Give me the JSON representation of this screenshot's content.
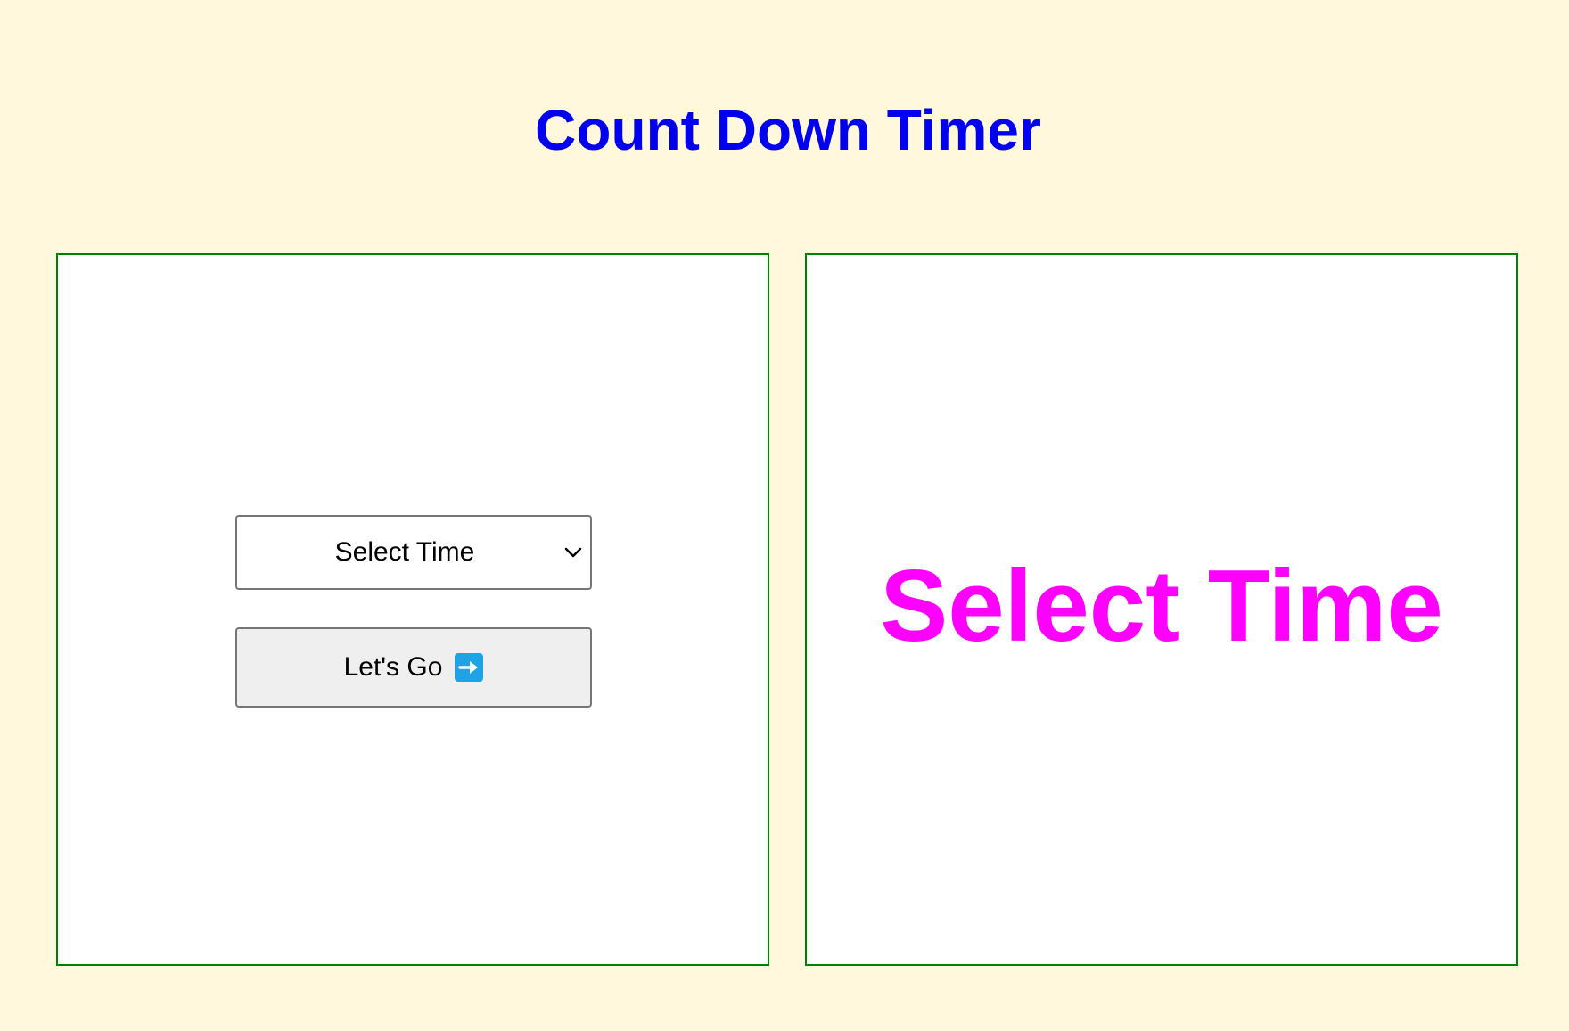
{
  "header": {
    "title": "Count Down Timer"
  },
  "controls": {
    "select": {
      "selected": "Select Time",
      "icon": "chevron-down-icon"
    },
    "button": {
      "label": "Let's Go",
      "icon": "right-arrow-icon"
    }
  },
  "display": {
    "text": "Select Time"
  },
  "colors": {
    "background": "#fff8dc",
    "title": "#0000ee",
    "panel_border": "#008000",
    "display_text": "#ff00ff",
    "arrow_badge": "#1ea3e6"
  }
}
